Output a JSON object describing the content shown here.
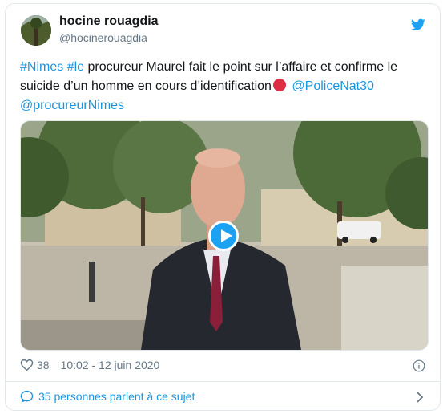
{
  "author": {
    "name": "hocine rouagdia",
    "handle": "@hocinerouagdia"
  },
  "tweet": {
    "hashtag1": "#Nimes",
    "hashtag2": "#le",
    "text_part1": " procureur Maurel fait le point sur l’affaire et confirme le suicide d’un homme en cours d’identification",
    "mention1": "@PoliceNat30",
    "mention2": "@procureurNimes"
  },
  "meta": {
    "likes": "38",
    "timestamp": "10:02 - 12 juin 2020"
  },
  "conversation": {
    "label": "35 personnes parlent à ce sujet"
  },
  "colors": {
    "link": "#1b95e0",
    "twitter_blue": "#1da1f2",
    "red_circle": "#dd2e44"
  },
  "icons": [
    "twitter-bird-icon",
    "play-icon",
    "heart-icon",
    "info-icon",
    "chat-bubble-icon",
    "chevron-right-icon"
  ]
}
